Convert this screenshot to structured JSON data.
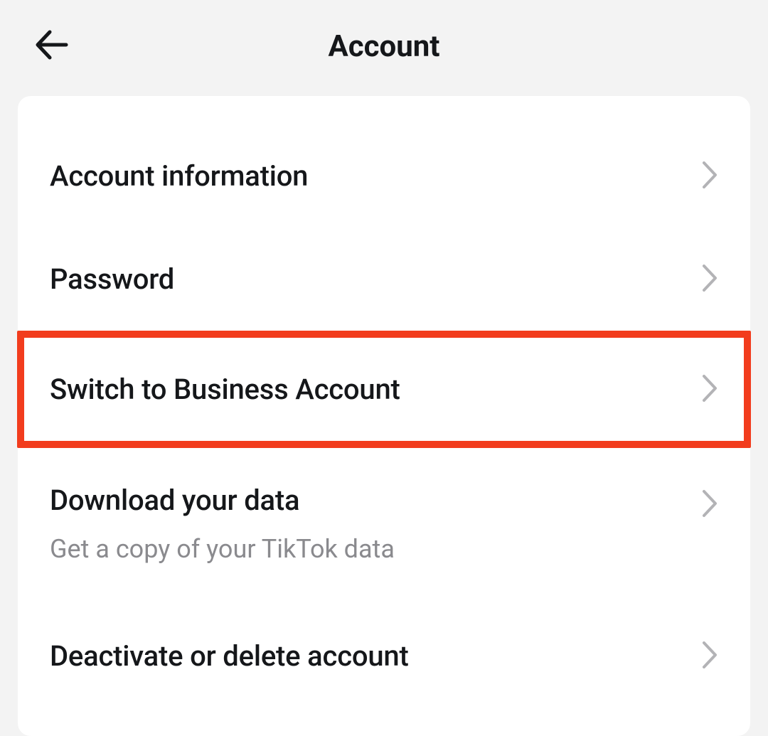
{
  "header": {
    "title": "Account"
  },
  "settings": {
    "items": [
      {
        "label": "Account information"
      },
      {
        "label": "Password"
      },
      {
        "label": "Switch to Business Account",
        "highlighted": true
      },
      {
        "label": "Download your data",
        "subtitle": "Get a copy of your TikTok data"
      },
      {
        "label": "Deactivate or delete account"
      }
    ]
  }
}
